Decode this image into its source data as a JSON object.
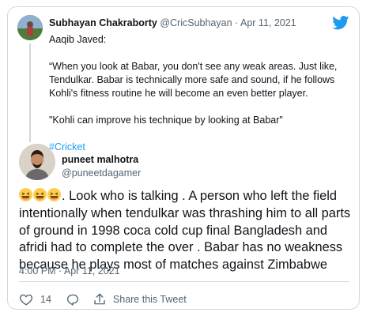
{
  "quoted_tweet": {
    "author_name": "Subhayan Chakraborty",
    "handle": "@CricSubhayan",
    "separator": "·",
    "date": "Apr 11, 2021",
    "body": [
      "Aaqib Javed:",
      "",
      "“When you look at Babar, you don't see any weak areas. Just like, Tendulkar. Babar is technically more safe and sound, if he follows Kohli's fitness routine he will become an even better player.",
      "",
      "\"Kohli can improve his technique by looking at Babar\"",
      ""
    ],
    "hashtag": "#Cricket"
  },
  "reply": {
    "author_name": "puneet malhotra",
    "handle": "@puneetdagamer",
    "emoji_count": 3,
    "text": ". Look who is talking . A person who left the field intentionally when tendulkar was  thrashing him to all parts of ground in 1998 coca cold cup final Bangladesh and afridi had to complete the over . Babar has no weakness because he plays most of matches against Zimbabwe",
    "timestamp": "4:00 PM · Apr 11, 2021"
  },
  "actions": {
    "like_count": "14",
    "share_label": "Share this Tweet"
  },
  "colors": {
    "text": "#0f1419",
    "secondary": "#536471",
    "accent": "#1d9bf0",
    "border": "#cfd9de"
  },
  "icons": [
    "twitter-bird-icon",
    "heart-icon",
    "reply-bubble-icon",
    "share-icon",
    "grinning-squinting-face-emoji"
  ]
}
